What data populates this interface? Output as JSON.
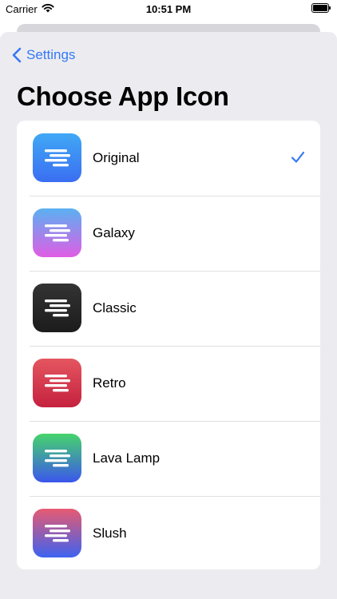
{
  "status_bar": {
    "carrier": "Carrier",
    "time": "10:51 PM"
  },
  "nav": {
    "back_label": "Settings"
  },
  "page_title": "Choose App Icon",
  "accent_color": "#3478f6",
  "icons": [
    {
      "label": "Original",
      "selected": true,
      "gradient": [
        "#40a8f5",
        "#3a6ef2"
      ]
    },
    {
      "label": "Galaxy",
      "selected": false,
      "gradient": [
        "#5ab1f2",
        "#e05de4"
      ]
    },
    {
      "label": "Classic",
      "selected": false,
      "gradient": [
        "#333333",
        "#1c1c1c"
      ]
    },
    {
      "label": "Retro",
      "selected": false,
      "gradient": [
        "#e45660",
        "#c5213e"
      ]
    },
    {
      "label": "Lava Lamp",
      "selected": false,
      "gradient": [
        "#46d46c",
        "#3b56ec"
      ]
    },
    {
      "label": "Slush",
      "selected": false,
      "gradient": [
        "#e75a72",
        "#3d62f0"
      ]
    }
  ]
}
